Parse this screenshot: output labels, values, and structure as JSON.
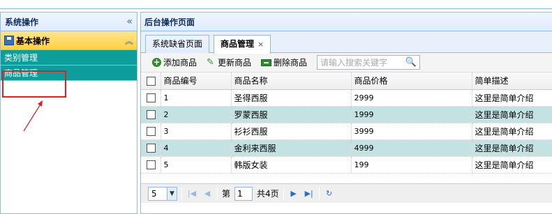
{
  "west": {
    "title": "系统操作",
    "collapse_icon": "«",
    "accordion_title": "基本操作",
    "items": [
      {
        "label": "类别管理"
      },
      {
        "label": "商品管理"
      }
    ]
  },
  "center": {
    "title": "后台操作页面",
    "tabs": [
      {
        "label": "系统缺省页面"
      },
      {
        "label": "商品管理",
        "close": "×"
      }
    ],
    "toolbar": {
      "add": "添加商品",
      "update": "更新商品",
      "delete": "删除商品",
      "search_placeholder": "请输入搜索关键字"
    },
    "grid": {
      "columns": [
        "商品编号",
        "商品名称",
        "商品价格",
        "简单描述"
      ],
      "rows": [
        {
          "id": "1",
          "name": "圣得西服",
          "price": "2999",
          "desc": "这里是简单介绍"
        },
        {
          "id": "2",
          "name": "罗蒙西服",
          "price": "1999",
          "desc": "这里是简单介绍"
        },
        {
          "id": "3",
          "name": "衫衫西服",
          "price": "3999",
          "desc": "这里是简单介绍"
        },
        {
          "id": "4",
          "name": "金利来西服",
          "price": "4999",
          "desc": "这里是简单介绍"
        },
        {
          "id": "5",
          "name": "韩版女装",
          "price": "199",
          "desc": "这里是简单介绍"
        }
      ]
    },
    "pager": {
      "page_size": "5",
      "page_prefix": "第",
      "page_value": "1",
      "page_suffix": "共4页"
    }
  },
  "colors": {
    "nav_bg": "#0d9e9b",
    "row_alt": "#c4e2e2",
    "annotation": "#e02020"
  }
}
